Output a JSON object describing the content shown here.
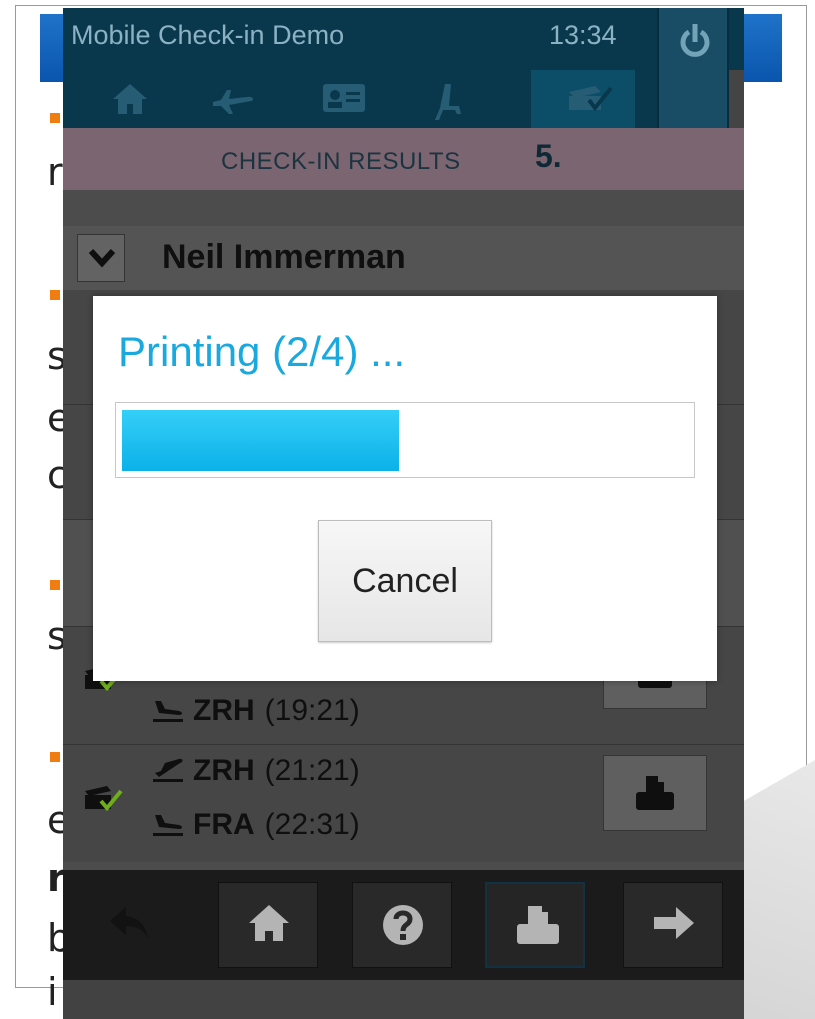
{
  "app": {
    "title": "Mobile Check-in Demo",
    "clock": "13:34",
    "step_label": "CHECK-IN RESULTS",
    "step_number": "5.",
    "tabs": [
      {
        "name": "home-icon"
      },
      {
        "name": "flight-icon"
      },
      {
        "name": "id-card-icon"
      },
      {
        "name": "seat-icon"
      },
      {
        "name": "checkin-done-icon",
        "active": true
      }
    ],
    "passenger": {
      "name": "Neil Immerman"
    },
    "segments": [
      {
        "departure": {
          "code": "",
          "time": ""
        },
        "arrival": {
          "code": "ZRH",
          "time": "(19:21)"
        }
      },
      {
        "departure": {
          "code": "ZRH",
          "time": "(21:21)"
        },
        "arrival": {
          "code": "FRA",
          "time": "(22:31)"
        }
      }
    ],
    "toolbar": [
      {
        "name": "back-arrow-icon"
      },
      {
        "name": "home-icon"
      },
      {
        "name": "help-icon"
      },
      {
        "name": "print-icon",
        "active": true
      },
      {
        "name": "forward-arrow-icon"
      }
    ]
  },
  "dialog": {
    "title": "Printing (2/4) ...",
    "progress": 0.49,
    "cancel_label": "Cancel"
  },
  "background_slide": {
    "fragments": [
      "r",
      "s",
      "e",
      "c",
      "s",
      "e",
      "r",
      "b",
      "i"
    ]
  },
  "colors": {
    "accent": "#1aa9df",
    "titlebar": "#0b3f56",
    "step_banner": "#8a717e",
    "checkmark": "#7cc11e",
    "bullet": "#f07d10"
  }
}
